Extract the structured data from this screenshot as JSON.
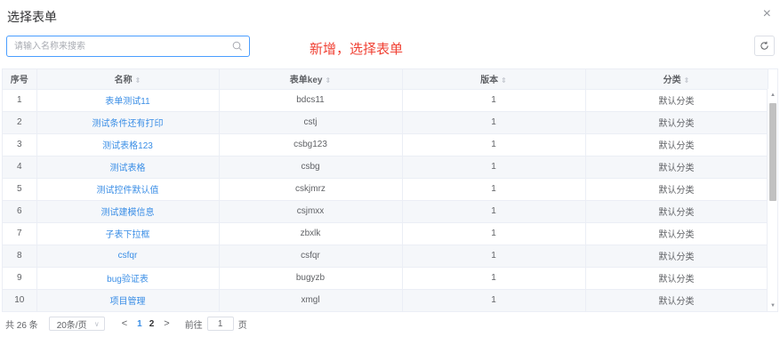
{
  "dialog": {
    "title": "选择表单",
    "close_glyph": "×"
  },
  "search": {
    "placeholder": "请输入名称来搜索",
    "value": ""
  },
  "annotation": "新增，选择表单",
  "table": {
    "columns": [
      {
        "label": "序号",
        "sortable": false
      },
      {
        "label": "名称",
        "sortable": true
      },
      {
        "label": "表单key",
        "sortable": true
      },
      {
        "label": "版本",
        "sortable": true
      },
      {
        "label": "分类",
        "sortable": true
      }
    ],
    "sort_glyph": "⇕",
    "rows": [
      {
        "index": "1",
        "name": "表单测试11",
        "key": "bdcs11",
        "version": "1",
        "category": "默认分类"
      },
      {
        "index": "2",
        "name": "测试条件还有打印",
        "key": "cstj",
        "version": "1",
        "category": "默认分类"
      },
      {
        "index": "3",
        "name": "测试表格123",
        "key": "csbg123",
        "version": "1",
        "category": "默认分类"
      },
      {
        "index": "4",
        "name": "测试表格",
        "key": "csbg",
        "version": "1",
        "category": "默认分类"
      },
      {
        "index": "5",
        "name": "测试控件默认值",
        "key": "cskjmrz",
        "version": "1",
        "category": "默认分类"
      },
      {
        "index": "6",
        "name": "测试建模信息",
        "key": "csjmxx",
        "version": "1",
        "category": "默认分类"
      },
      {
        "index": "7",
        "name": "子表下拉框",
        "key": "zbxlk",
        "version": "1",
        "category": "默认分类"
      },
      {
        "index": "8",
        "name": "csfqr",
        "key": "csfqr",
        "version": "1",
        "category": "默认分类"
      },
      {
        "index": "9",
        "name": "bug验证表",
        "key": "bugyzb",
        "version": "1",
        "category": "默认分类"
      },
      {
        "index": "10",
        "name": "项目管理",
        "key": "xmgl",
        "version": "1",
        "category": "默认分类"
      }
    ]
  },
  "pagination": {
    "total": "共 26 条",
    "page_size": "20条/页",
    "prev": "<",
    "next": ">",
    "pages": [
      "1",
      "2"
    ],
    "current_page": "2",
    "goto_label": "前往",
    "goto_value": "1",
    "goto_suffix": "页"
  },
  "colors": {
    "accent": "#3a8ee6",
    "annotation": "#f04134",
    "stripe": "#f5f7fa"
  }
}
